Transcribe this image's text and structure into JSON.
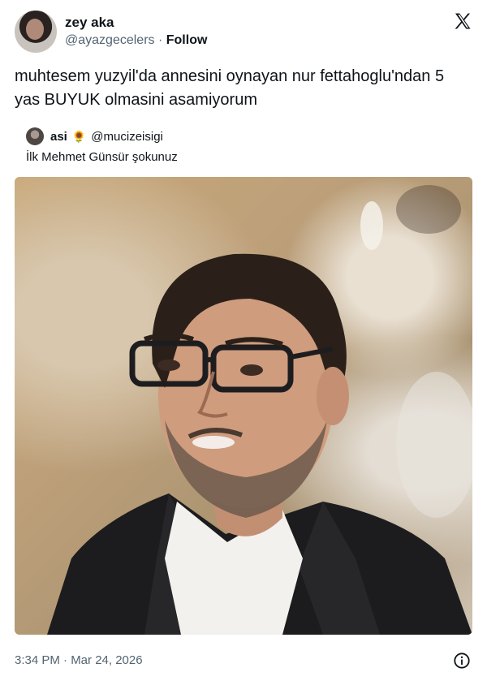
{
  "author": {
    "name": "zey aka",
    "handle": "@ayazgecelers",
    "separator": "·",
    "follow_label": "Follow"
  },
  "tweet": {
    "text": "muhtesem yuzyil'da annesini oynayan nur fettahoglu'ndan 5 yas BUYUK olmasini asamiyorum"
  },
  "quoted": {
    "name": "asi",
    "emoji": "🌻",
    "handle": "@mucizeisigi",
    "text": "İlk Mehmet Günsür şokunuz"
  },
  "footer": {
    "timestamp": "3:34 PM · Mar 24, 2026"
  },
  "icons": {
    "brand": "x-logo-icon",
    "info": "info-icon"
  },
  "colors": {
    "text": "#0f1419",
    "secondary": "#536471"
  }
}
